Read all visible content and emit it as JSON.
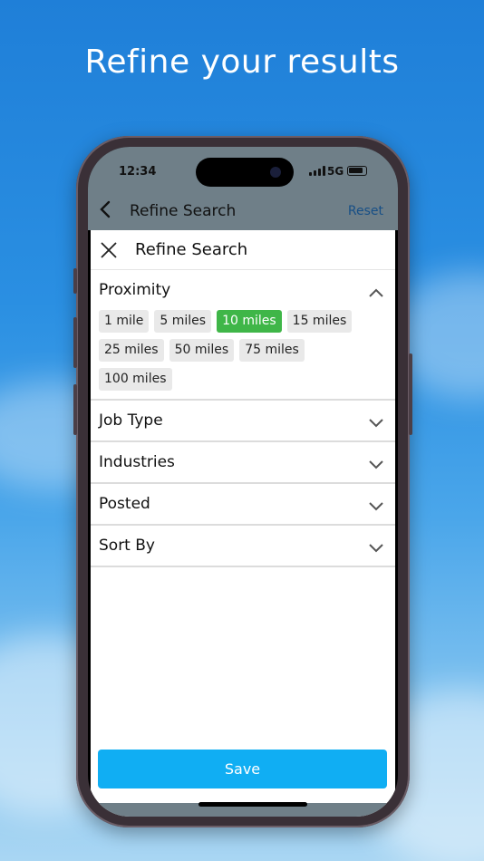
{
  "headline": "Refine your results",
  "status_bar": {
    "time": "12:34",
    "network": "5G"
  },
  "nav": {
    "back_icon": "chevron-left-icon",
    "title": "Refine Search",
    "reset_label": "Reset"
  },
  "sheet": {
    "title": "Refine Search",
    "close_icon": "close-icon",
    "sections": [
      {
        "title": "Proximity",
        "expanded": true,
        "options": [
          "1 mile",
          "5 miles",
          "10 miles",
          "15 miles",
          "25 miles",
          "50 miles",
          "75 miles",
          "100 miles"
        ],
        "selected": "10 miles"
      },
      {
        "title": "Job Type",
        "expanded": false
      },
      {
        "title": "Industries",
        "expanded": false
      },
      {
        "title": "Posted",
        "expanded": false
      },
      {
        "title": "Sort By",
        "expanded": false
      }
    ],
    "save_label": "Save"
  },
  "colors": {
    "accent_green": "#3fb648",
    "save_blue": "#10aef3",
    "reset_blue": "#174f86"
  }
}
